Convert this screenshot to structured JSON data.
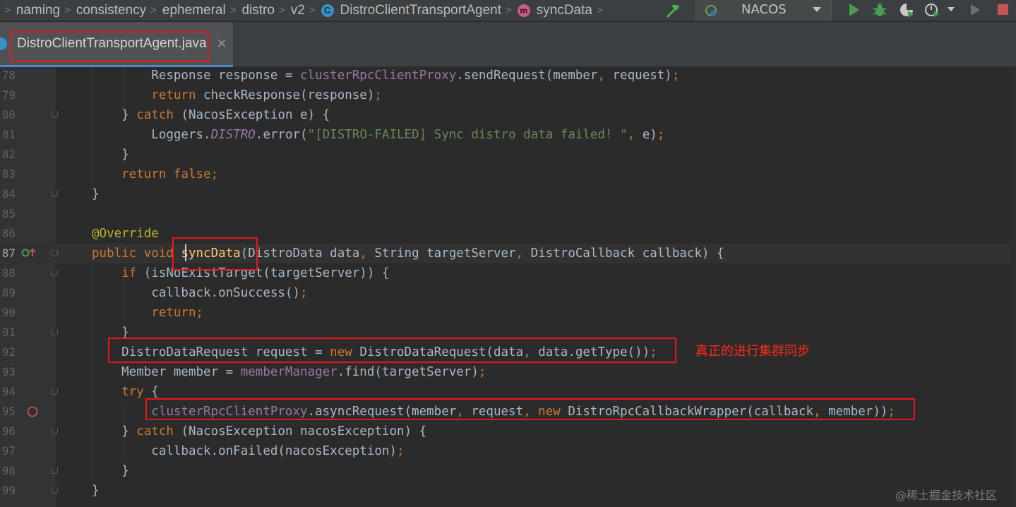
{
  "breadcrumb": [
    "naming",
    "consistency",
    "ephemeral",
    "distro",
    "v2",
    "DistroClientTransportAgent",
    "syncData"
  ],
  "run_config": "NACOS",
  "tab": {
    "label": "DistroClientTransportAgent.java",
    "close": "×"
  },
  "code": [
    {
      "n": "78",
      "segs": [
        [
          "",
          "        Response response = "
        ],
        [
          "fld",
          "clusterRpcClientProxy"
        ],
        [
          "",
          ".sendRequest(member"
        ],
        [
          "kw",
          ","
        ],
        [
          "",
          " request)"
        ],
        [
          "kw",
          ";"
        ]
      ]
    },
    {
      "n": "79",
      "segs": [
        [
          "kw",
          "        return "
        ],
        [
          "",
          "checkResponse(response)"
        ],
        [
          "kw",
          ";"
        ]
      ]
    },
    {
      "n": "80",
      "segs": [
        [
          "",
          "    } "
        ],
        [
          "kw",
          "catch "
        ],
        [
          "",
          "(NacosException e) {"
        ]
      ]
    },
    {
      "n": "81",
      "segs": [
        [
          "",
          "        Loggers."
        ],
        [
          "st",
          "DISTRO"
        ],
        [
          "",
          ".error("
        ],
        [
          "str",
          "\"[DISTRO-FAILED] Sync distro data failed! \""
        ],
        [
          "kw",
          ","
        ],
        [
          "",
          " e)"
        ],
        [
          "kw",
          ";"
        ]
      ]
    },
    {
      "n": "82",
      "segs": [
        [
          "",
          "    }"
        ]
      ]
    },
    {
      "n": "83",
      "segs": [
        [
          "kw",
          "    return false;"
        ]
      ]
    },
    {
      "n": "84",
      "segs": [
        [
          "",
          "}"
        ]
      ]
    },
    {
      "n": "85",
      "segs": [
        [
          "",
          ""
        ]
      ]
    },
    {
      "n": "86",
      "segs": [
        [
          "ann",
          "@Override"
        ]
      ]
    },
    {
      "n": "87",
      "segs": [
        [
          "kw",
          "public void "
        ],
        [
          "mth",
          "syncData"
        ],
        [
          "",
          "(DistroData data"
        ],
        [
          "kw",
          ","
        ],
        [
          "",
          " String targetServer"
        ],
        [
          "kw",
          ","
        ],
        [
          "",
          " DistroCallback callback) {"
        ]
      ]
    },
    {
      "n": "88",
      "segs": [
        [
          "kw",
          "    if "
        ],
        [
          "",
          "(isNoExistTarget(targetServer)) {"
        ]
      ]
    },
    {
      "n": "89",
      "segs": [
        [
          "",
          "        callback.onSuccess()"
        ],
        [
          "kw",
          ";"
        ]
      ]
    },
    {
      "n": "90",
      "segs": [
        [
          "kw",
          "        return;"
        ]
      ]
    },
    {
      "n": "91",
      "segs": [
        [
          "",
          "    }"
        ]
      ]
    },
    {
      "n": "92",
      "segs": [
        [
          "",
          "    DistroDataRequest request = "
        ],
        [
          "kw",
          "new "
        ],
        [
          "",
          "DistroDataRequest(data"
        ],
        [
          "kw",
          ","
        ],
        [
          "",
          " data.getType())"
        ],
        [
          "kw",
          ";"
        ]
      ]
    },
    {
      "n": "93",
      "segs": [
        [
          "",
          "    Member member = "
        ],
        [
          "fld",
          "memberManager"
        ],
        [
          "",
          ".find(targetServer)"
        ],
        [
          "kw",
          ";"
        ]
      ]
    },
    {
      "n": "94",
      "segs": [
        [
          "kw",
          "    try "
        ],
        [
          "",
          "{"
        ]
      ]
    },
    {
      "n": "95",
      "segs": [
        [
          "fld",
          "        clusterRpcClientProxy"
        ],
        [
          "",
          ".asyncRequest(member"
        ],
        [
          "kw",
          ","
        ],
        [
          "",
          " request"
        ],
        [
          "kw",
          ", new "
        ],
        [
          "",
          "DistroRpcCallbackWrapper(callback"
        ],
        [
          "kw",
          ","
        ],
        [
          "",
          " member))"
        ],
        [
          "kw",
          ";"
        ]
      ]
    },
    {
      "n": "96",
      "segs": [
        [
          "",
          "    } "
        ],
        [
          "kw",
          "catch "
        ],
        [
          "",
          "(NacosException nacosException) {"
        ]
      ]
    },
    {
      "n": "97",
      "segs": [
        [
          "",
          "        callback.onFailed(nacosException)"
        ],
        [
          "kw",
          ";"
        ]
      ]
    },
    {
      "n": "98",
      "segs": [
        [
          "",
          "    }"
        ]
      ]
    },
    {
      "n": "99",
      "segs": [
        [
          "",
          "}"
        ]
      ]
    }
  ],
  "annotation": "真正的进行集群同步",
  "watermark": "@稀土掘金技术社区",
  "colors": {
    "keyword": "#cc7832",
    "string": "#6a8759",
    "field": "#9876aa",
    "method": "#ffc66d",
    "annotation": "#bbb529",
    "highlight_box": "#e8161a"
  },
  "icons": [
    "class-icon",
    "method-icon",
    "hammer-icon",
    "run-icon",
    "debug-icon",
    "coverage-icon",
    "profile-icon",
    "stop-icon",
    "breakpoint-icon",
    "override-icon"
  ]
}
